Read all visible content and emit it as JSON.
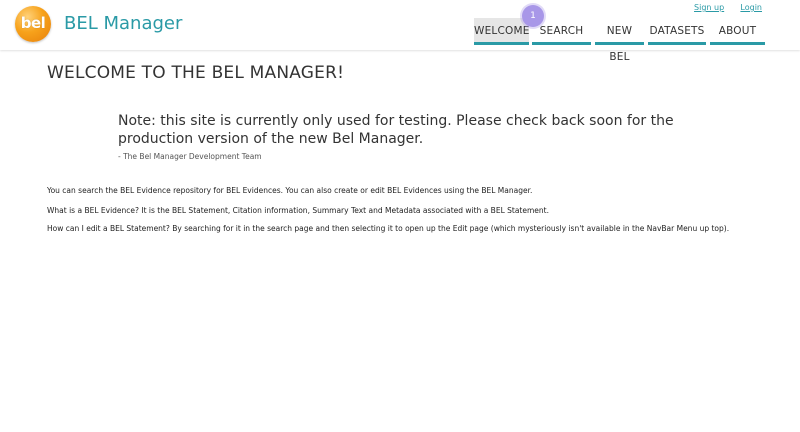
{
  "header": {
    "logo_text": "bel",
    "brand": "BEL Manager",
    "links": {
      "sign_up": "Sign up",
      "login": "Login"
    }
  },
  "nav": {
    "items": [
      "WELCOME",
      "SEARCH",
      "NEW BEL",
      "DATASETS",
      "ABOUT"
    ],
    "active": "WELCOME"
  },
  "marker": {
    "label": "1"
  },
  "main": {
    "title": "WELCOME TO THE BEL MANAGER!",
    "note": "Note: this site is currently only used for testing. Please check back soon for the production version of the new Bel Manager.",
    "signature": "- The Bel Manager Development Team",
    "paragraphs": [
      "You can search the BEL Evidence repository for BEL Evidences. You can also create or edit BEL Evidences using the BEL Manager.",
      "What is a BEL Evidence? It is the BEL Statement, Citation information, Summary Text and Metadata associated with a BEL Statement.",
      "How can I edit a BEL Statement? By searching for it in the search page and then selecting it to open up the Edit page (which mysteriously isn't available in the NavBar Menu up top)."
    ]
  },
  "colors": {
    "accent": "#2a9aa6",
    "logo": "#f7a21b",
    "marker": "#a897e8",
    "active_tab_bg": "#e6e6e6"
  }
}
